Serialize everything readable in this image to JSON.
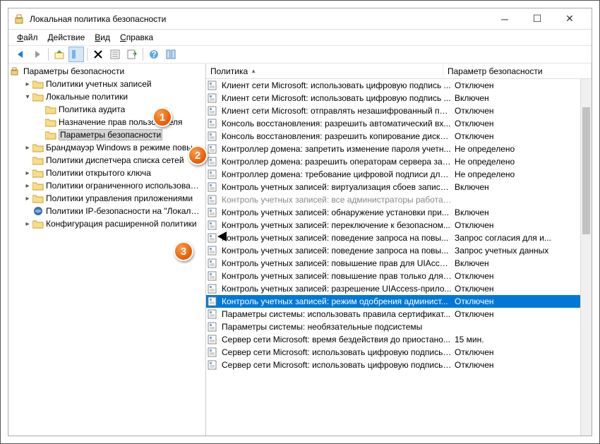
{
  "window": {
    "title": "Локальная политика безопасности"
  },
  "menu": {
    "file": "Файл",
    "action": "Действие",
    "view": "Вид",
    "help": "Справка"
  },
  "tree": {
    "root": "Параметры безопасности",
    "items": [
      {
        "indent": 1,
        "exp": ">",
        "icon": "folder",
        "label": "Политики учетных записей"
      },
      {
        "indent": 1,
        "exp": "v",
        "icon": "folder",
        "label": "Локальные политики",
        "cal": 1
      },
      {
        "indent": 2,
        "exp": " ",
        "icon": "folder",
        "label": "Политика аудита"
      },
      {
        "indent": 2,
        "exp": " ",
        "icon": "folder",
        "label": "Назначение прав пользователя"
      },
      {
        "indent": 2,
        "exp": " ",
        "icon": "folder",
        "label": "Параметры безопасности",
        "sel": true,
        "cal": 2
      },
      {
        "indent": 1,
        "exp": ">",
        "icon": "folder",
        "label": "Брандмауэр Windows в режиме повышенной безопасности"
      },
      {
        "indent": 1,
        "exp": " ",
        "icon": "folder",
        "label": "Политики диспетчера списка сетей"
      },
      {
        "indent": 1,
        "exp": ">",
        "icon": "folder",
        "label": "Политики открытого ключа"
      },
      {
        "indent": 1,
        "exp": ">",
        "icon": "folder",
        "label": "Политики ограниченного использования"
      },
      {
        "indent": 1,
        "exp": ">",
        "icon": "folder",
        "label": "Политики управления приложениями"
      },
      {
        "indent": 1,
        "exp": " ",
        "icon": "ipsec",
        "label": "Политики IP-безопасности на \"Локальный компьютер\""
      },
      {
        "indent": 1,
        "exp": ">",
        "icon": "folder",
        "label": "Конфигурация расширенной политики",
        "cal": 3
      }
    ]
  },
  "list": {
    "header_policy": "Политика",
    "header_setting": "Параметр безопасности",
    "rows": [
      {
        "pol": "Клиент сети Microsoft: использовать цифровую подпись ...",
        "val": "Отключен"
      },
      {
        "pol": "Клиент сети Microsoft: использовать цифровую подпись ...",
        "val": "Включен"
      },
      {
        "pol": "Клиент сети Microsoft: отправлять незашифрованный пар...",
        "val": "Отключен"
      },
      {
        "pol": "Консоль восстановления: разрешить автоматический вх...",
        "val": "Отключен"
      },
      {
        "pol": "Консоль восстановления: разрешить копирование диске...",
        "val": "Отключен"
      },
      {
        "pol": "Контроллер домена: запретить изменение пароля учетн...",
        "val": "Не определено"
      },
      {
        "pol": "Контроллер домена: разрешить операторам сервера зад...",
        "val": "Не определено"
      },
      {
        "pol": "Контроллер домена: требование цифровой подписи для ...",
        "val": "Не определено"
      },
      {
        "pol": "Контроль учетных записей: виртуализация сбоев записи ...",
        "val": "Включен"
      },
      {
        "pol": "Контроль учетных записей: все администраторы работают в режиме одобрения администрат",
        "val": "",
        "dim": true
      },
      {
        "pol": "Контроль учетных записей: обнаружение установки при...",
        "val": "Включен"
      },
      {
        "pol": "Контроль учетных записей: переключение к безопасном...",
        "val": "Отключен"
      },
      {
        "pol": "Контроль учетных записей: поведение запроса на повы...",
        "val": "Запрос согласия для и..."
      },
      {
        "pol": "Контроль учетных записей: поведение запроса на повы...",
        "val": "Запрос учетных данных"
      },
      {
        "pol": "Контроль учетных записей: повышение прав для UIAcces...",
        "val": "Включен"
      },
      {
        "pol": "Контроль учетных записей: повышение прав только для ...",
        "val": "Отключен"
      },
      {
        "pol": "Контроль учетных записей: разрешение UIAccess-прило...",
        "val": "Отключен"
      },
      {
        "pol": "Контроль учетных записей: режим одобрения админист...",
        "val": "Отключен",
        "sel": true
      },
      {
        "pol": "Параметры системы: использовать правила сертификат...",
        "val": "Отключен"
      },
      {
        "pol": "Параметры системы: необязательные подсистемы",
        "val": ""
      },
      {
        "pol": "Сервер сети Microsoft: время бездействия до приостано...",
        "val": "15 мин."
      },
      {
        "pol": "Сервер сети Microsoft: использовать цифровую подпись ...",
        "val": "Отключен"
      },
      {
        "pol": "Сервер сети Microsoft: использовать цифровую подпись ...",
        "val": "Отключен"
      }
    ]
  },
  "callouts": {
    "1": "1",
    "2": "2",
    "3": "3"
  }
}
